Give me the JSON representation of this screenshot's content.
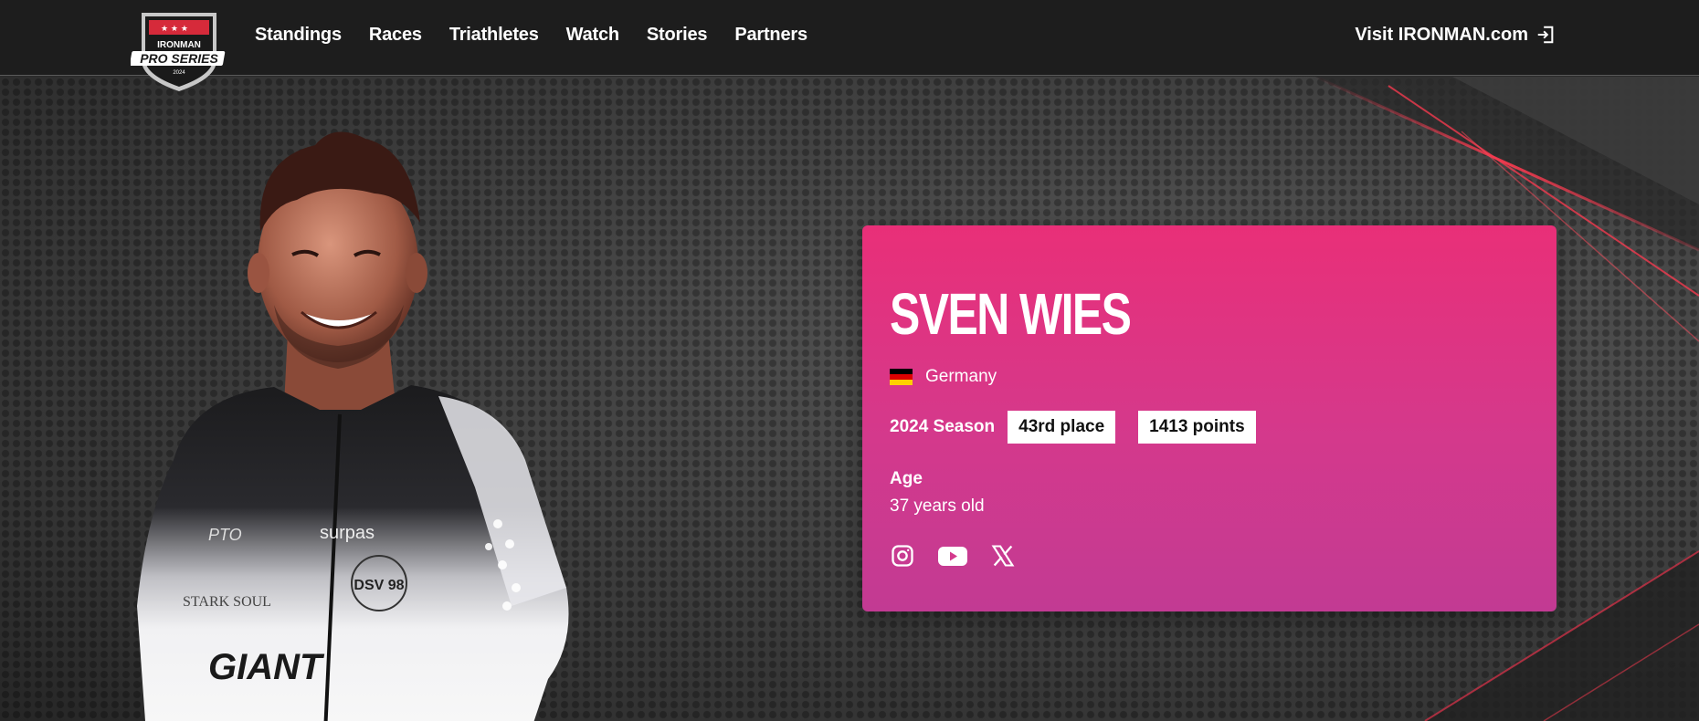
{
  "nav": {
    "logo": {
      "top": "IRONMAN",
      "bottom": "PRO SERIES",
      "year": "2024"
    },
    "links": [
      "Standings",
      "Races",
      "Triathletes",
      "Watch",
      "Stories",
      "Partners"
    ],
    "visit_label": "Visit IRONMAN.com"
  },
  "athlete": {
    "name": "SVEN WIES",
    "country": "Germany",
    "season_label": "2024 Season",
    "place": "43rd place",
    "points": "1413 points",
    "age_label": "Age",
    "age_value": "37 years old",
    "jersey": {
      "sponsor1": "PTO",
      "sponsor2": "surpas",
      "sponsor3": "STARK SOUL",
      "club": "DSV 98",
      "brand": "GIANT"
    }
  },
  "socials": [
    "instagram-icon",
    "youtube-icon",
    "x-icon"
  ],
  "colors": {
    "nav_bg": "#1d1d1d",
    "card_top": "#e92f78",
    "card_bottom": "#c23a93",
    "accent_red": "#e0324a"
  }
}
